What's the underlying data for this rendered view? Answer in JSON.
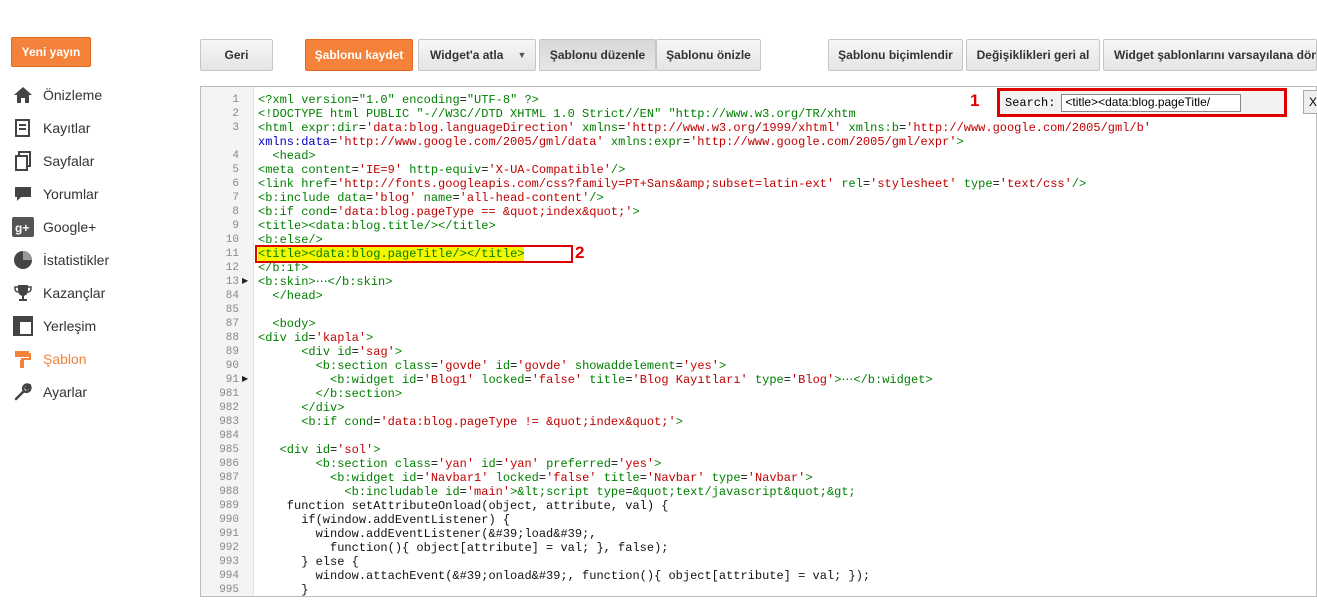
{
  "sidebar": {
    "new_post": "Yeni yayın",
    "items": [
      {
        "label": "Önizleme",
        "icon": "home-icon"
      },
      {
        "label": "Kayıtlar",
        "icon": "posts-icon"
      },
      {
        "label": "Sayfalar",
        "icon": "pages-icon"
      },
      {
        "label": "Yorumlar",
        "icon": "comments-icon"
      },
      {
        "label": "Google+",
        "icon": "google-plus-icon"
      },
      {
        "label": "İstatistikler",
        "icon": "stats-icon"
      },
      {
        "label": "Kazançlar",
        "icon": "trophy-icon"
      },
      {
        "label": "Yerleşim",
        "icon": "layout-icon"
      },
      {
        "label": "Şablon",
        "icon": "template-icon",
        "active": true
      },
      {
        "label": "Ayarlar",
        "icon": "wrench-icon"
      }
    ]
  },
  "toolbar": {
    "back": "Geri",
    "save": "Şablonu kaydet",
    "jump_widget": "Widget'a atla",
    "edit": "Şablonu düzenle",
    "preview": "Şablonu önizle",
    "format": "Şablonu biçimlendir",
    "revert": "Değişiklikleri geri al",
    "reset_widgets": "Widget şablonlarını varsayılana döndür"
  },
  "search": {
    "label": "Search:",
    "value": "<title><data:blog.pageTitle/",
    "close": "X"
  },
  "markers": {
    "one": "1",
    "two": "2"
  },
  "accent_color": "#f4823a",
  "highlight_color": "#e00000",
  "code_lines": [
    {
      "n": "1",
      "text": "<?xml version=\"1.0\" encoding=\"UTF-8\" ?>"
    },
    {
      "n": "2",
      "text": "<!DOCTYPE html PUBLIC \"-//W3C//DTD XHTML 1.0 Strict//EN\" \"http://www.w3.org/TR/xhtm"
    },
    {
      "n": "3",
      "text": "<html expr:dir='data:blog.languageDirection' xmlns='http://www.w3.org/1999/xhtml' xmlns:b='http://www.google.com/2005/gml/b'"
    },
    {
      "n": "",
      "text": "xmlns:data='http://www.google.com/2005/gml/data' xmlns:expr='http://www.google.com/2005/gml/expr'>"
    },
    {
      "n": "4",
      "text": "  <head>"
    },
    {
      "n": "5",
      "text": "<meta content='IE=9' http-equiv='X-UA-Compatible'/>"
    },
    {
      "n": "6",
      "text": "<link href='http://fonts.googleapis.com/css?family=PT+Sans&amp;subset=latin-ext' rel='stylesheet' type='text/css'/>"
    },
    {
      "n": "7",
      "text": "<b:include data='blog' name='all-head-content'/>"
    },
    {
      "n": "8",
      "text": "<b:if cond='data:blog.pageType == &quot;index&quot;'>"
    },
    {
      "n": "9",
      "text": "<title><data:blog.title/></title>"
    },
    {
      "n": "10",
      "text": "<b:else/>"
    },
    {
      "n": "11",
      "text": "<title><data:blog.pageTitle/></title>",
      "highlight": true
    },
    {
      "n": "12",
      "text": "</b:if>"
    },
    {
      "n": "13",
      "text": "<b:skin>⋯</b:skin>",
      "arrow": true
    },
    {
      "n": "84",
      "text": "  </head>"
    },
    {
      "n": "85",
      "text": ""
    },
    {
      "n": "87",
      "text": "  <body>"
    },
    {
      "n": "88",
      "text": "<div id='kapla'>"
    },
    {
      "n": "89",
      "text": "      <div id='sag'>"
    },
    {
      "n": "90",
      "text": "        <b:section class='govde' id='govde' showaddelement='yes'>"
    },
    {
      "n": "91",
      "text": "          <b:widget id='Blog1' locked='false' title='Blog Kayıtları' type='Blog'>⋯</b:widget>",
      "arrow": true
    },
    {
      "n": "981",
      "text": "        </b:section>"
    },
    {
      "n": "982",
      "text": "      </div>"
    },
    {
      "n": "983",
      "text": "      <b:if cond='data:blog.pageType != &quot;index&quot;'>"
    },
    {
      "n": "984",
      "text": ""
    },
    {
      "n": "985",
      "text": "   <div id='sol'>"
    },
    {
      "n": "986",
      "text": "        <b:section class='yan' id='yan' preferred='yes'>"
    },
    {
      "n": "987",
      "text": "          <b:widget id='Navbar1' locked='false' title='Navbar' type='Navbar'>"
    },
    {
      "n": "988",
      "text": "            <b:includable id='main'>&lt;script type=&quot;text/javascript&quot;&gt;"
    },
    {
      "n": "989",
      "text": "    function setAttributeOnload(object, attribute, val) {"
    },
    {
      "n": "990",
      "text": "      if(window.addEventListener) {"
    },
    {
      "n": "991",
      "text": "        window.addEventListener(&#39;load&#39;,"
    },
    {
      "n": "992",
      "text": "          function(){ object[attribute] = val; }, false);"
    },
    {
      "n": "993",
      "text": "      } else {"
    },
    {
      "n": "994",
      "text": "        window.attachEvent(&#39;onload&#39;, function(){ object[attribute] = val; });"
    },
    {
      "n": "995",
      "text": "      }"
    }
  ]
}
